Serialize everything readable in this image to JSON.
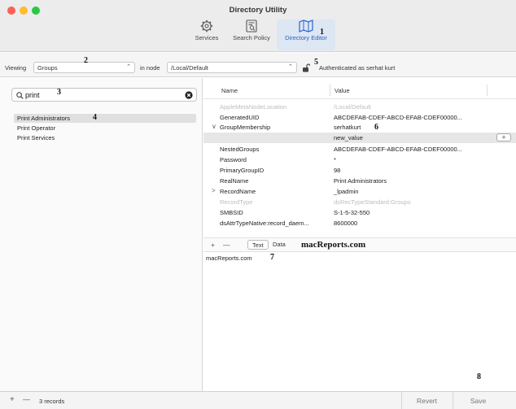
{
  "window": {
    "title": "Directory Utility",
    "toolbar": [
      {
        "label": "Services",
        "icon": "gear-icon"
      },
      {
        "label": "Search Policy",
        "icon": "document-search-icon"
      },
      {
        "label": "Directory Editor",
        "icon": "map-icon",
        "active": true
      }
    ]
  },
  "annotations": [
    "1",
    "2",
    "3",
    "4",
    "5",
    "6",
    "7",
    "8"
  ],
  "viewbar": {
    "viewing_label": "Viewing",
    "record_type": "Groups",
    "node_label": "in node",
    "node": "/Local/Default",
    "auth_text": "Authenticated as serhat kurt"
  },
  "search": {
    "value": "print"
  },
  "records": [
    {
      "label": "Print Administrators",
      "selected": true
    },
    {
      "label": "Print Operator"
    },
    {
      "label": "Print Services"
    }
  ],
  "table": {
    "headers": {
      "name": "Name",
      "value": "Value"
    },
    "rows": [
      {
        "name": "AppleMetaNodeLocation",
        "value": "/Local/Default",
        "dim": true
      },
      {
        "name": "GeneratedUID",
        "value": "ABCDEFAB-CDEF-ABCD-EFAB-CDEF00000..."
      },
      {
        "name": "GroupMembership",
        "value": "serhatkurt",
        "disclosure": "∨"
      },
      {
        "name": "",
        "value": "new_value",
        "selected": true
      },
      {
        "name": "NestedGroups",
        "value": "ABCDEFAB-CDEF-ABCD-EFAB-CDEF00000..."
      },
      {
        "name": "Password",
        "value": "*"
      },
      {
        "name": "PrimaryGroupID",
        "value": "98"
      },
      {
        "name": "RealName",
        "value": "Print Administrators"
      },
      {
        "name": "RecordName",
        "value": "_lpadmin",
        "disclosure": ">"
      },
      {
        "name": "RecordType",
        "value": "dsRecTypeStandard:Groups",
        "dim": true
      },
      {
        "name": "SMBSID",
        "value": "S-1-5-32-550"
      },
      {
        "name": "dsAttrTypeNative:record_daem...",
        "value": "8600000"
      }
    ]
  },
  "editbar": {
    "plus": "+",
    "minus": "—",
    "text_tab": "Text",
    "data_tab": "Data",
    "watermark": "macReports.com"
  },
  "editor_text": "macReports.com",
  "status": {
    "plus": "+",
    "minus": "—",
    "count": "3 records",
    "revert": "Revert",
    "save": "Save"
  }
}
